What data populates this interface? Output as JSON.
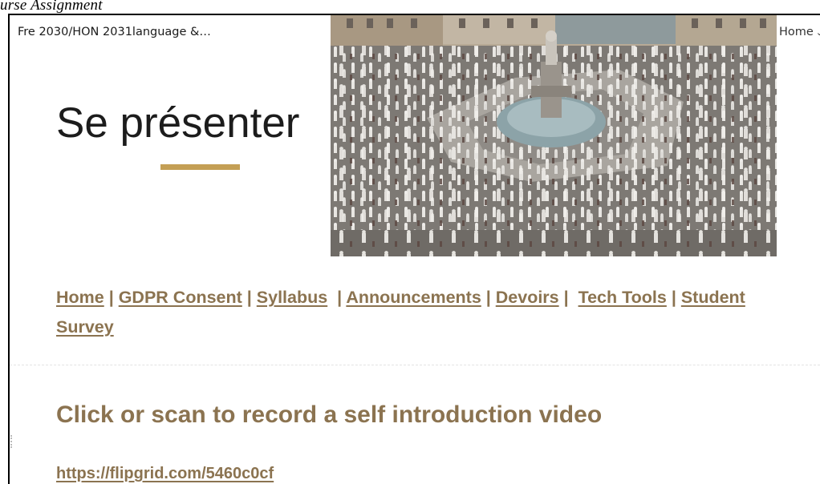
{
  "caption": "urse Assignment",
  "header": {
    "site_title": "Fre 2030/HON 2031language &…",
    "nav_home": "Home"
  },
  "page": {
    "title": "Se présenter"
  },
  "nav_links": [
    {
      "label": "Home",
      "sep": " | "
    },
    {
      "label": "GDPR Consent",
      "sep": " | "
    },
    {
      "label": "Syllabus",
      "sep": "  | "
    },
    {
      "label": "Announcements",
      "sep": " | "
    },
    {
      "label": "Devoirs",
      "sep": " |  "
    },
    {
      "label": "Tech Tools",
      "sep": " | "
    },
    {
      "label": "Student Survey",
      "sep": ""
    }
  ],
  "section": {
    "heading": "Click or scan to record a self introduction video",
    "link": "https://flipgrid.com/5460c0cf"
  },
  "colors": {
    "accent_gold": "#c49f55",
    "link_brown": "#8b7350"
  },
  "icons": {
    "nav_dropdown": "chevron-down-icon"
  }
}
